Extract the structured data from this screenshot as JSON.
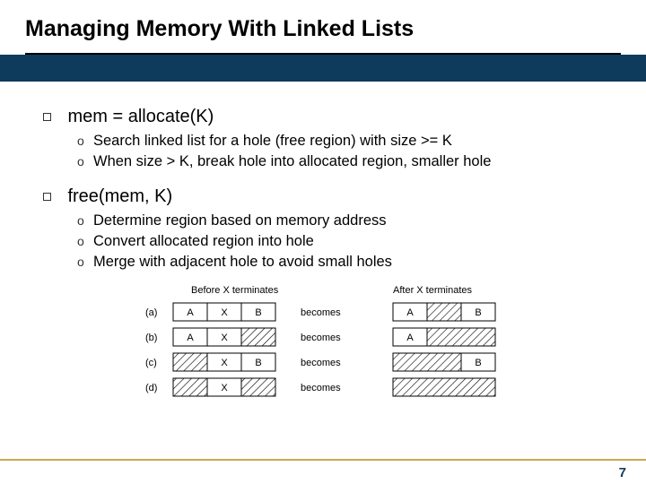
{
  "title": "Managing Memory With Linked Lists",
  "sections": [
    {
      "heading": "mem = allocate(K)",
      "items": [
        "Search linked list for a hole (free region) with size >= K",
        "When size > K, break hole into allocated region, smaller hole"
      ]
    },
    {
      "heading": "free(mem, K)",
      "items": [
        "Determine region based on memory address",
        "Convert allocated region into hole",
        "Merge with adjacent hole to avoid small holes"
      ]
    }
  ],
  "diagram": {
    "header_left": "Before X terminates",
    "header_right": "After X terminates",
    "becomes": "becomes",
    "rows": [
      {
        "label": "(a)",
        "before": [
          "A",
          "X",
          "B"
        ],
        "after": [
          "A",
          "",
          "B"
        ]
      },
      {
        "label": "(b)",
        "before": [
          "A",
          "X",
          ""
        ],
        "after": [
          "A",
          "",
          ""
        ]
      },
      {
        "label": "(c)",
        "before": [
          "",
          "X",
          "B"
        ],
        "after": [
          "",
          "",
          "B"
        ]
      },
      {
        "label": "(d)",
        "before": [
          "",
          "X",
          ""
        ],
        "after": [
          "",
          "",
          ""
        ]
      }
    ]
  },
  "page_number": "7"
}
